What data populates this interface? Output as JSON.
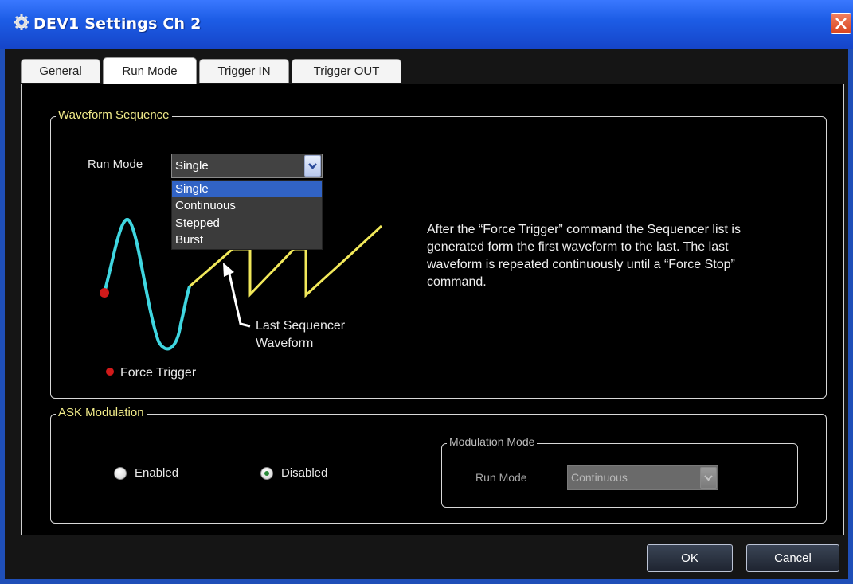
{
  "window": {
    "title": "DEV1 Settings Ch 2"
  },
  "tabs": [
    {
      "label": "General"
    },
    {
      "label": "Run Mode"
    },
    {
      "label": "Trigger IN"
    },
    {
      "label": "Trigger OUT"
    }
  ],
  "active_tab": "Run Mode",
  "waveform_sequence": {
    "title": "Waveform Sequence",
    "run_mode_label": "Run Mode",
    "run_mode_value": "Single",
    "options": [
      "Single",
      "Continuous",
      "Stepped",
      "Burst"
    ],
    "diagram": {
      "last_waveform_label_line1": "Last Sequencer",
      "last_waveform_label_line2": "Waveform",
      "force_trigger_label": "Force Trigger"
    },
    "description": "After the “Force Trigger” command the Sequencer list is generated form the first waveform to the last. The last waveform is repeated continuously until a “Force Stop” command."
  },
  "ask_modulation": {
    "title": "ASK Modulation",
    "enabled_label": "Enabled",
    "disabled_label": "Disabled",
    "selected": "Disabled",
    "modulation_mode": {
      "title": "Modulation Mode",
      "run_mode_label": "Run Mode",
      "run_mode_value": "Continuous"
    }
  },
  "buttons": {
    "ok": "OK",
    "cancel": "Cancel"
  },
  "colors": {
    "title_bar": "#1d5de6",
    "group_title": "#f2ec8a",
    "wave_cyan": "#3fd6e0",
    "wave_yellow": "#f1e85a",
    "trigger_dot": "#d11a1a"
  }
}
